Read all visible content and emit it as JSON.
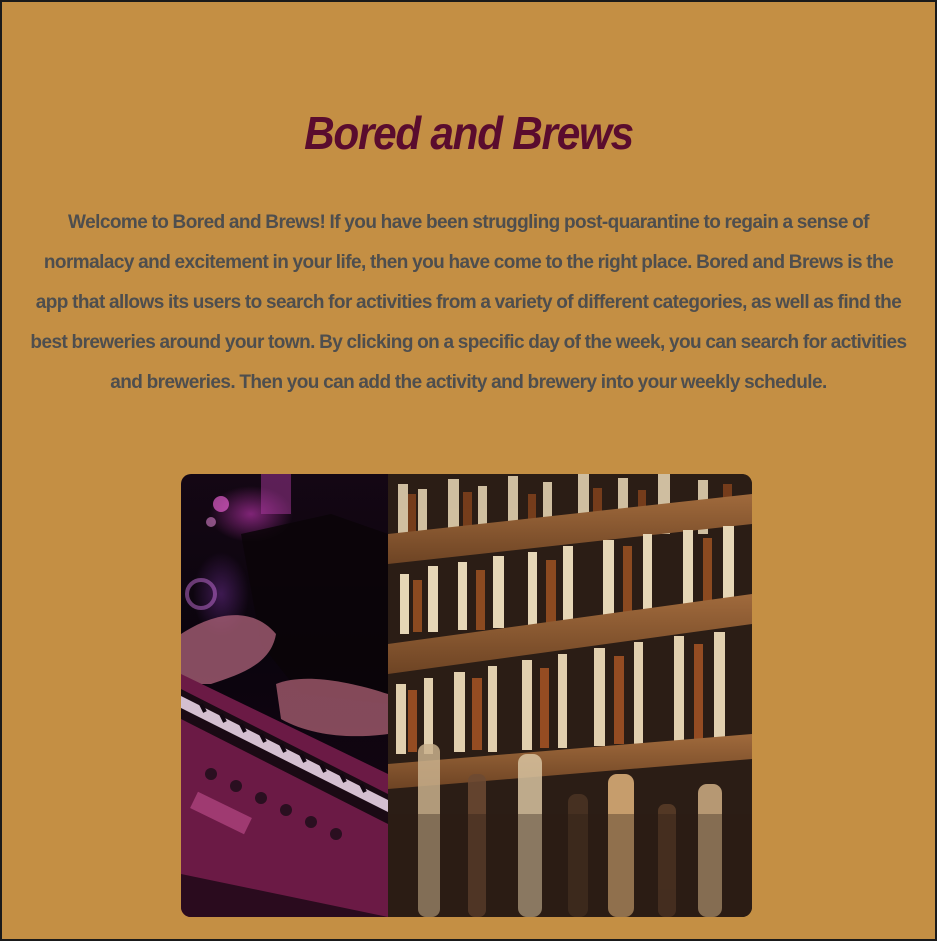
{
  "header": {
    "title": "Bored and Brews"
  },
  "intro": {
    "text": "Welcome to Bored and Brews! If you have been struggling post-quarantine to regain a sense of normalacy and excitement in your life, then you have come to the right place. Bored and Brews is the app that allows its users to search for activities from a variety of different categories, as well as find the best breweries around your town. By clicking on a specific day of the week, you can search for activities and breweries. Then you can add the activity and brewery into your weekly schedule."
  },
  "gallery": {
    "images": [
      {
        "subject": "person playing a keyboard synthesizer under pink and purple stage lights"
      },
      {
        "subject": "wooden bar shelves stocked with liquor bottles"
      }
    ]
  },
  "colors": {
    "background": "#c48f44",
    "title": "#5a0c2e",
    "body_text": "#4e4e4e"
  }
}
